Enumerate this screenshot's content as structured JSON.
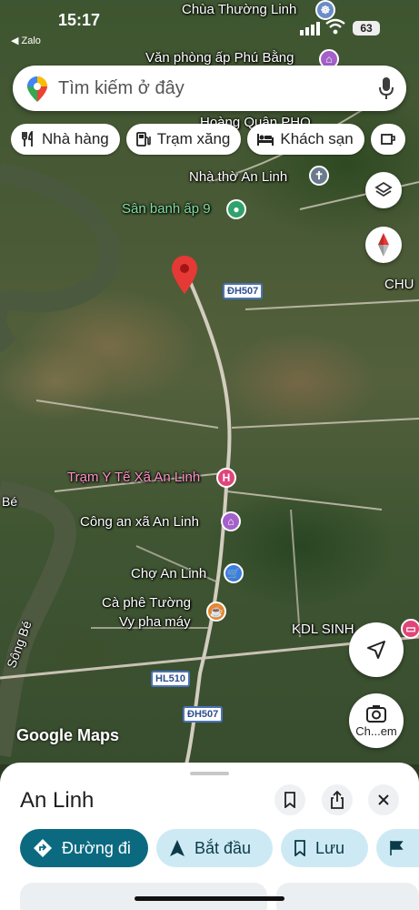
{
  "status_bar": {
    "time": "15:17",
    "back_app": "◀ Zalo",
    "battery": "63"
  },
  "search": {
    "placeholder": "Tìm kiếm ở đây"
  },
  "chips": [
    {
      "label": "Nhà hàng",
      "icon": "restaurant-icon"
    },
    {
      "label": "Trạm xăng",
      "icon": "gas-station-icon"
    },
    {
      "label": "Khách sạn",
      "icon": "hotel-icon"
    }
  ],
  "map": {
    "labels": {
      "chua_thuong_linh": "Chùa Thường Linh",
      "van_phong_ap": "Văn phòng ấp Phú Bằng",
      "hoang_quan": "Hoàng Quân PHO",
      "nha_tho": "Nhà thờ An Linh",
      "san_banh": "Sân banh ấp 9",
      "chu": "CHU",
      "tram_y_te": "Trạm Y Tế Xã An Linh",
      "cong_an": "Công an xã An Linh",
      "cho": "Chợ An Linh",
      "ca_phe_1": "Cà phê Tường",
      "ca_phe_2": "Vy pha máy",
      "kdl": "KDL SINH",
      "song_be_1": "Bé",
      "song_be_2": "Sông Bé",
      "google_maps": "Google Maps",
      "search_camera": "Ch...em"
    },
    "shields": {
      "dh507_top": "ĐH507",
      "hl510": "HL510",
      "dh507_bottom": "ĐH507"
    }
  },
  "sheet": {
    "title": "An Linh",
    "actions": {
      "directions": "Đường đi",
      "start": "Bắt đầu",
      "save": "Lưu"
    }
  }
}
